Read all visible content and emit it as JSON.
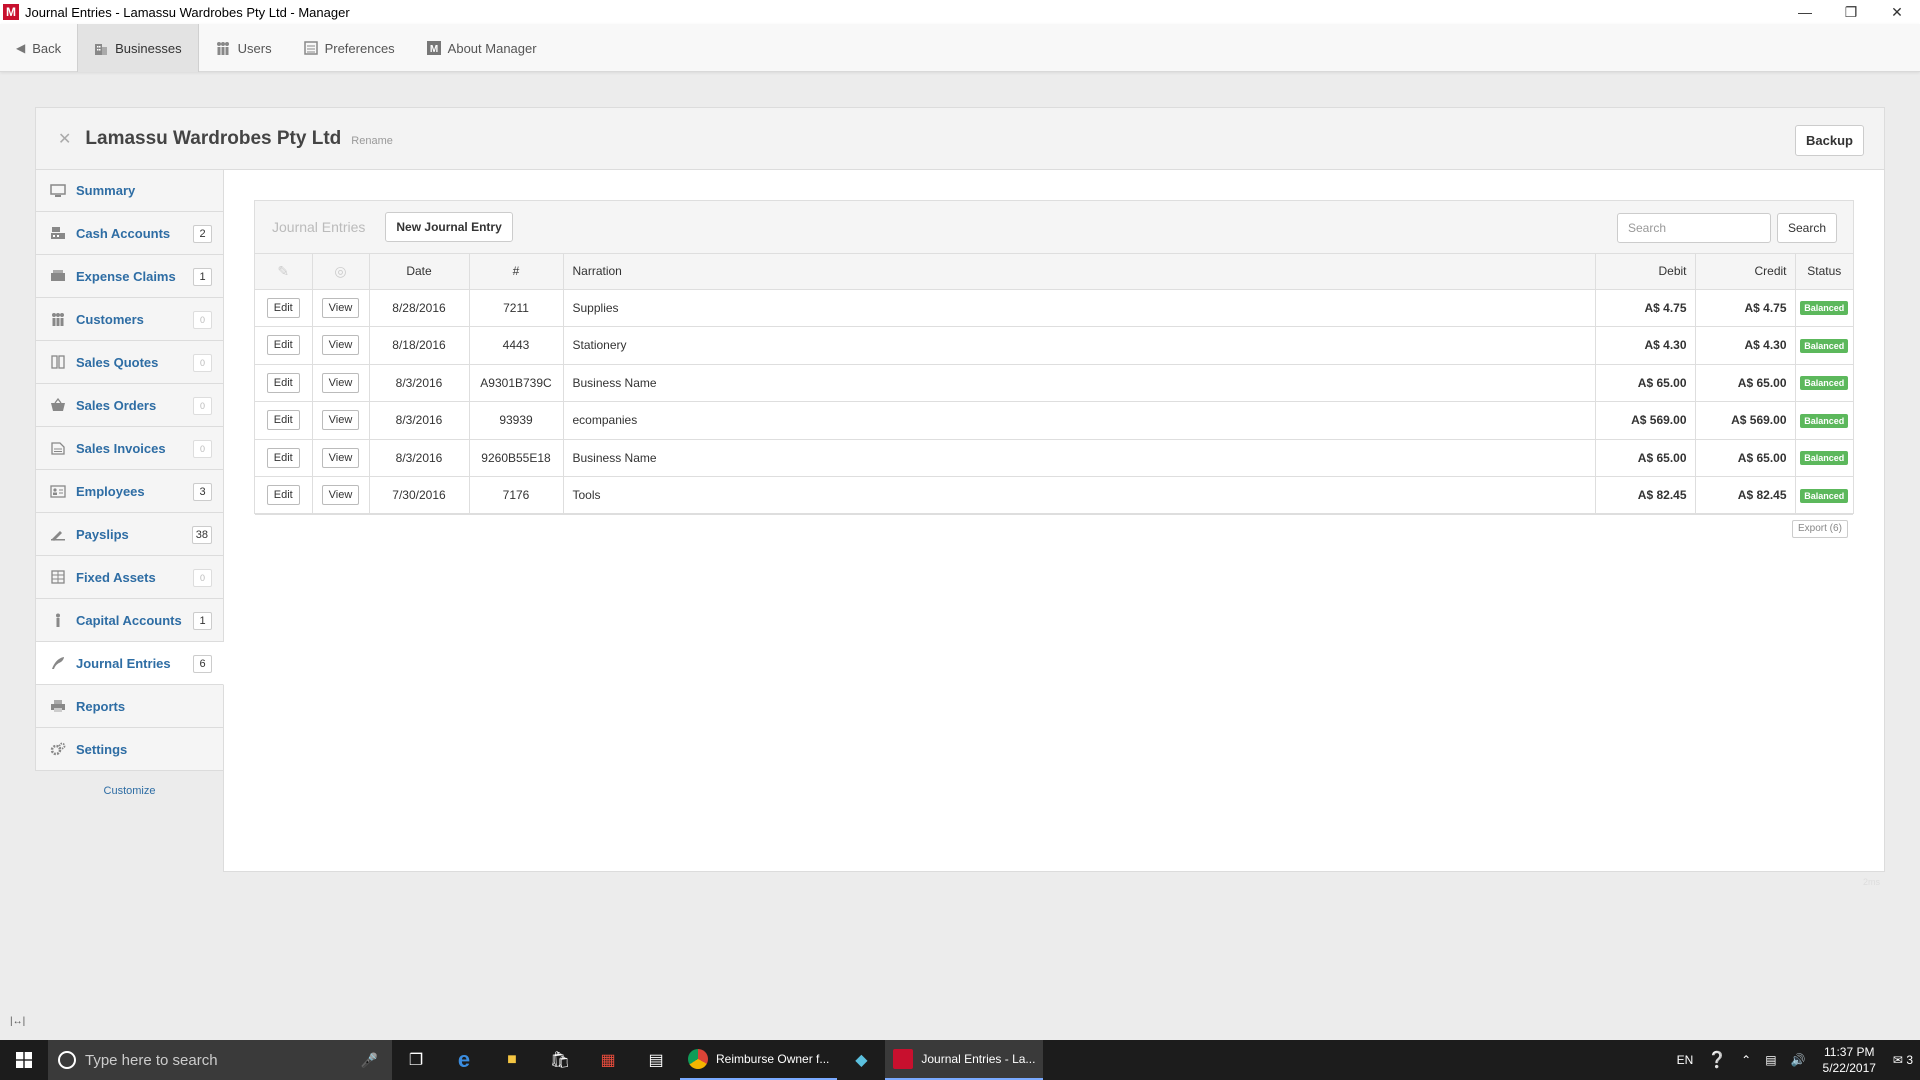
{
  "window": {
    "title": "Journal Entries - Lamassu Wardrobes Pty Ltd - Manager",
    "logo": "M"
  },
  "topnav": [
    {
      "label": "Back",
      "icon": "back-arrow-icon",
      "active": false
    },
    {
      "label": "Businesses",
      "icon": "building-icon",
      "active": true
    },
    {
      "label": "Users",
      "icon": "users-icon",
      "active": false
    },
    {
      "label": "Preferences",
      "icon": "preferences-icon",
      "active": false
    },
    {
      "label": "About Manager",
      "icon": "manager-logo-icon",
      "active": false
    }
  ],
  "business": {
    "name": "Lamassu Wardrobes Pty Ltd",
    "rename": "Rename",
    "backup": "Backup"
  },
  "sidebar": {
    "items": [
      {
        "label": "Summary",
        "icon": "monitor-icon",
        "count": ""
      },
      {
        "label": "Cash Accounts",
        "icon": "cash-register-icon",
        "count": "2"
      },
      {
        "label": "Expense Claims",
        "icon": "expense-icon",
        "count": "1"
      },
      {
        "label": "Customers",
        "icon": "customers-icon",
        "count": "0"
      },
      {
        "label": "Sales Quotes",
        "icon": "quote-icon",
        "count": "0"
      },
      {
        "label": "Sales Orders",
        "icon": "basket-icon",
        "count": "0"
      },
      {
        "label": "Sales Invoices",
        "icon": "invoice-icon",
        "count": "0"
      },
      {
        "label": "Employees",
        "icon": "employee-card-icon",
        "count": "3"
      },
      {
        "label": "Payslips",
        "icon": "payslip-icon",
        "count": "38"
      },
      {
        "label": "Fixed Assets",
        "icon": "building-grid-icon",
        "count": "0"
      },
      {
        "label": "Capital Accounts",
        "icon": "person-icon",
        "count": "1"
      },
      {
        "label": "Journal Entries",
        "icon": "quill-icon",
        "count": "6"
      },
      {
        "label": "Reports",
        "icon": "printer-icon",
        "count": ""
      },
      {
        "label": "Settings",
        "icon": "gears-icon",
        "count": ""
      }
    ],
    "customize": "Customize"
  },
  "journal": {
    "title": "Journal Entries",
    "new_button": "New Journal Entry",
    "search_placeholder": "Search",
    "search_button": "Search",
    "columns": {
      "date": "Date",
      "number": "#",
      "narration": "Narration",
      "debit": "Debit",
      "credit": "Credit",
      "status": "Status"
    },
    "edit_label": "Edit",
    "view_label": "View",
    "rows": [
      {
        "date": "8/28/2016",
        "number": "7211",
        "narration": "Supplies",
        "debit": "A$ 4.75",
        "credit": "A$ 4.75",
        "status": "Balanced"
      },
      {
        "date": "8/18/2016",
        "number": "4443",
        "narration": "Stationery",
        "debit": "A$ 4.30",
        "credit": "A$ 4.30",
        "status": "Balanced"
      },
      {
        "date": "8/3/2016",
        "number": "A9301B739C",
        "narration": "Business Name",
        "debit": "A$ 65.00",
        "credit": "A$ 65.00",
        "status": "Balanced"
      },
      {
        "date": "8/3/2016",
        "number": "93939",
        "narration": "ecompanies",
        "debit": "A$ 569.00",
        "credit": "A$ 569.00",
        "status": "Balanced"
      },
      {
        "date": "8/3/2016",
        "number": "9260B55E18",
        "narration": "Business Name",
        "debit": "A$ 65.00",
        "credit": "A$ 65.00",
        "status": "Balanced"
      },
      {
        "date": "7/30/2016",
        "number": "7176",
        "narration": "Tools",
        "debit": "A$ 82.45",
        "credit": "A$ 82.45",
        "status": "Balanced"
      }
    ],
    "export": "Export (6)"
  },
  "footer": {
    "timing": "2ms",
    "resize": "|↔|"
  },
  "taskbar": {
    "search_placeholder": "Type here to search",
    "apps": [
      {
        "label": "Reimburse Owner f...",
        "active": false
      },
      {
        "label": "Journal Entries - La...",
        "active": true
      }
    ],
    "language": "EN",
    "time": "11:37 PM",
    "date": "5/22/2017",
    "notifications": "3"
  },
  "colors": {
    "link": "#2e6da4",
    "badge": "#5cb85c",
    "brand": "#c8102e"
  }
}
